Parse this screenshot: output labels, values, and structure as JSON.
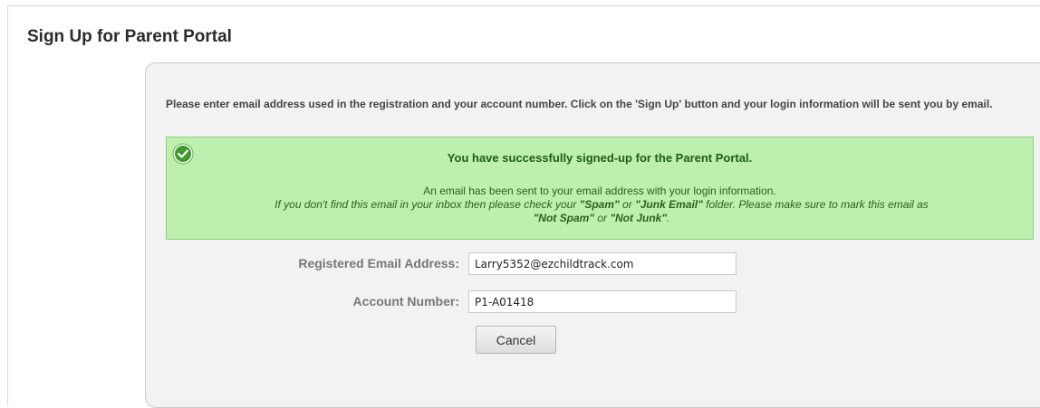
{
  "page": {
    "title": "Sign Up for Parent Portal"
  },
  "instructions": "Please enter email address used in the registration and your account number. Click on the 'Sign Up' button and your login information will be sent you by email.",
  "success": {
    "icon": "check-circle-icon",
    "color": "#bdf0ae",
    "title": "You have successfully signed-up for the Parent Portal.",
    "line1": "An email has been sent to your email address with your login information.",
    "note_part1": "If you don't find this email in your inbox then please check your ",
    "spam_label": "\"Spam\"",
    "or_text1": " or ",
    "junk_label": "\"Junk Email\"",
    "note_part2": " folder. Please make sure to mark this email as ",
    "not_spam_label": "\"Not Spam\"",
    "or_text2": " or ",
    "not_junk_label": "\"Not Junk\"",
    "end_text": "."
  },
  "form": {
    "email_label": "Registered Email Address:",
    "email_value": "Larry5352@ezchildtrack.com",
    "account_label": "Account Number:",
    "account_value": "P1-A01418",
    "cancel_label": "Cancel"
  }
}
